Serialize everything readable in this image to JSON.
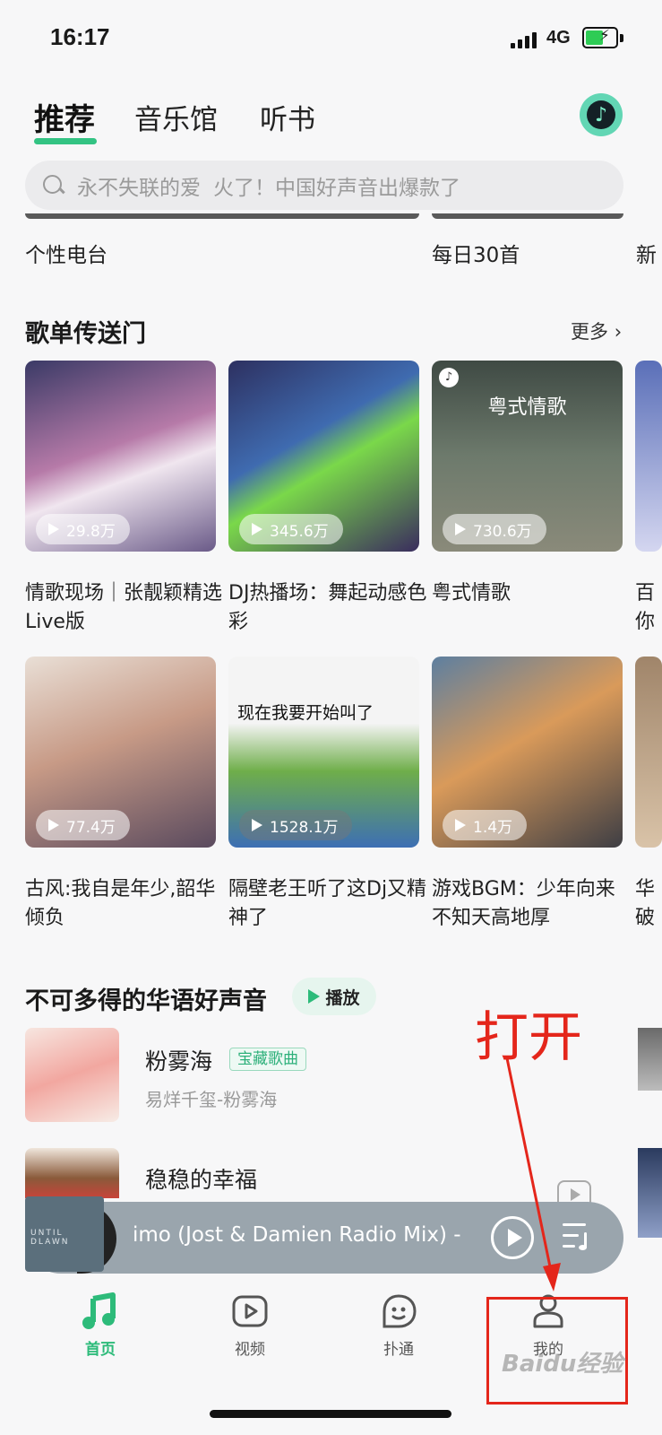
{
  "status_bar": {
    "time": "16:17",
    "network": "4G"
  },
  "top_tabs": [
    {
      "label": "推荐",
      "active": true
    },
    {
      "label": "音乐馆",
      "active": false
    },
    {
      "label": "听书",
      "active": false
    }
  ],
  "search": {
    "placeholder": "永不失联的爱",
    "hint": "火了！中国好声音出爆款了"
  },
  "quick_entries": [
    "个性电台",
    "每日30首",
    "新"
  ],
  "playlist_section": {
    "title": "歌单传送门",
    "more_label": "更多",
    "cards": [
      {
        "count": "29.8万",
        "title": "情歌现场｜张靓颖精选Live版"
      },
      {
        "count": "345.6万",
        "title": "DJ热播场：舞起动感色彩"
      },
      {
        "count": "730.6万",
        "title": "粤式情歌",
        "overlay": "粤式情歌"
      },
      {
        "count": "",
        "title": "百你"
      },
      {
        "count": "77.4万",
        "title": "古风:我自是年少,韶华倾负"
      },
      {
        "count": "1528.1万",
        "title": "隔壁老王听了这Dj又精神了",
        "overlay": "现在我要开始叫了"
      },
      {
        "count": "1.4万",
        "title": "游戏BGM：少年向来不知天高地厚"
      },
      {
        "count": "",
        "title": "华破"
      }
    ]
  },
  "song_section": {
    "title": "不可多得的华语好声音",
    "play_label": "播放",
    "songs": [
      {
        "title": "粉雾海",
        "badge": "宝藏歌曲",
        "subtitle": "易烊千玺-粉雾海"
      },
      {
        "title": "稳稳的幸福"
      }
    ]
  },
  "mini_player": {
    "title": "imo (Jost & Damien Radio Mix) -",
    "cover_text": "UNTIL DLAWN"
  },
  "bottom_nav": [
    {
      "label": "首页",
      "icon": "music-note-icon",
      "active": true
    },
    {
      "label": "视频",
      "icon": "video-play-icon",
      "active": false
    },
    {
      "label": "扑通",
      "icon": "chat-face-icon",
      "active": false
    },
    {
      "label": "我的",
      "icon": "user-profile-icon",
      "active": false
    }
  ],
  "annotation": {
    "text": "打开",
    "color": "#e4261b"
  },
  "watermark": "Baidu经验",
  "colors": {
    "accent": "#2dbb7a",
    "background": "#f7f7f8"
  }
}
